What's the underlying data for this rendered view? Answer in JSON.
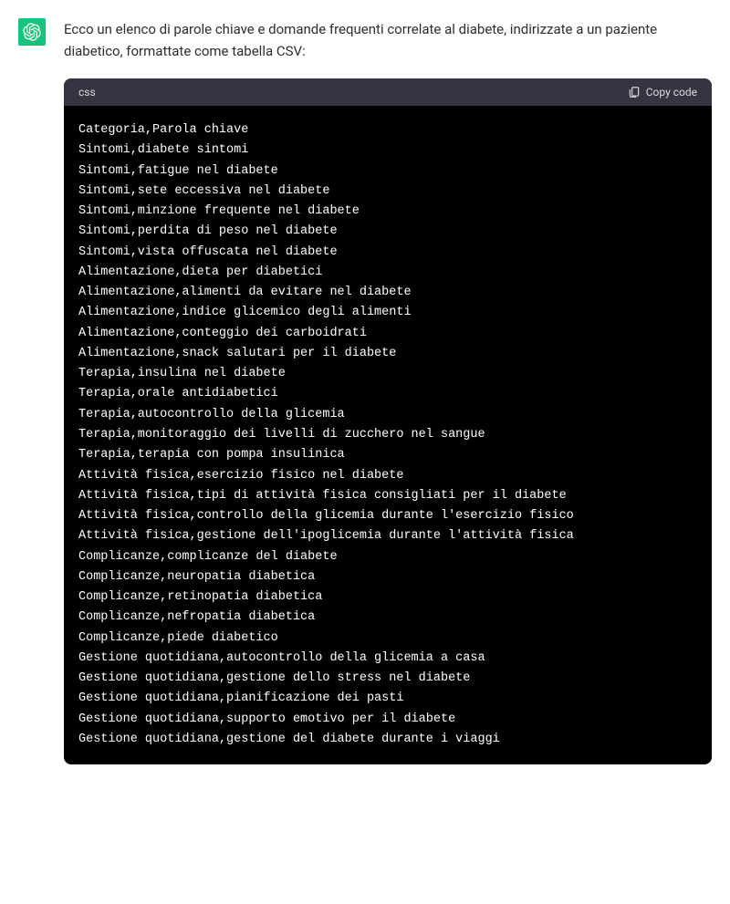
{
  "intro": "Ecco un elenco di parole chiave e domande frequenti correlate al diabete, indirizzate a un paziente diabetico, formattate come tabella CSV:",
  "code": {
    "language": "css",
    "copy_label": "Copy code",
    "lines": [
      "Categoria,Parola chiave",
      "Sintomi,diabete sintomi",
      "Sintomi,fatigue nel diabete",
      "Sintomi,sete eccessiva nel diabete",
      "Sintomi,minzione frequente nel diabete",
      "Sintomi,perdita di peso nel diabete",
      "Sintomi,vista offuscata nel diabete",
      "Alimentazione,dieta per diabetici",
      "Alimentazione,alimenti da evitare nel diabete",
      "Alimentazione,indice glicemico degli alimenti",
      "Alimentazione,conteggio dei carboidrati",
      "Alimentazione,snack salutari per il diabete",
      "Terapia,insulina nel diabete",
      "Terapia,orale antidiabetici",
      "Terapia,autocontrollo della glicemia",
      "Terapia,monitoraggio dei livelli di zucchero nel sangue",
      "Terapia,terapia con pompa insulinica",
      "Attività fisica,esercizio fisico nel diabete",
      "Attività fisica,tipi di attività fisica consigliati per il diabete",
      "Attività fisica,controllo della glicemia durante l'esercizio fisico",
      "Attività fisica,gestione dell'ipoglicemia durante l'attività fisica",
      "Complicanze,complicanze del diabete",
      "Complicanze,neuropatia diabetica",
      "Complicanze,retinopatia diabetica",
      "Complicanze,nefropatia diabetica",
      "Complicanze,piede diabetico",
      "Gestione quotidiana,autocontrollo della glicemia a casa",
      "Gestione quotidiana,gestione dello stress nel diabete",
      "Gestione quotidiana,pianificazione dei pasti",
      "Gestione quotidiana,supporto emotivo per il diabete",
      "Gestione quotidiana,gestione del diabete durante i viaggi"
    ]
  }
}
